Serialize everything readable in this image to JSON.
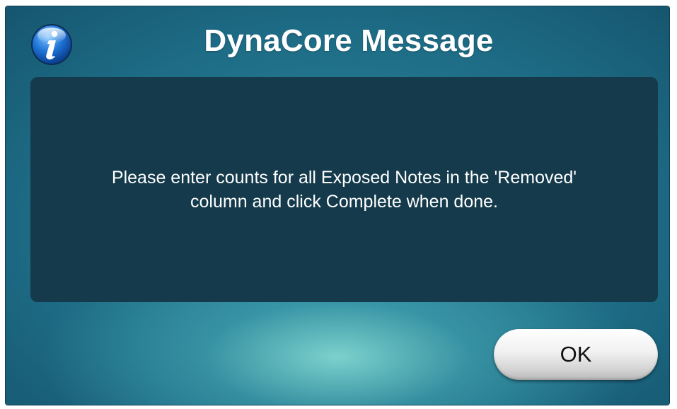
{
  "dialog": {
    "title": "DynaCore Message",
    "icon": "info-icon",
    "message": "Please enter counts for all Exposed Notes in the 'Removed'\ncolumn and click Complete when done.",
    "ok_label": "OK"
  },
  "colors": {
    "panel": "#143a4b",
    "background_dark": "#124a62",
    "background_glow": "#8ce1d7",
    "title_text": "#ffffff",
    "icon_blue": "#1f74d6"
  }
}
